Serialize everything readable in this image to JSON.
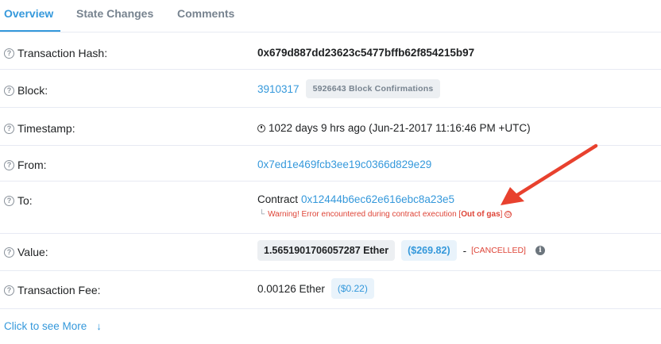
{
  "tabs": [
    {
      "label": "Overview",
      "active": true
    },
    {
      "label": "State Changes",
      "active": false
    },
    {
      "label": "Comments",
      "active": false
    }
  ],
  "rows": {
    "tx_hash": {
      "label": "Transaction Hash:",
      "value": "0x679d887dd23623c5477bffb62f854215b97"
    },
    "block": {
      "label": "Block:",
      "number": "3910317",
      "confirmations": "5926643 Block Confirmations"
    },
    "timestamp": {
      "label": "Timestamp:",
      "value": "1022 days 9 hrs ago (Jun-21-2017 11:16:46 PM +UTC)"
    },
    "from": {
      "label": "From:",
      "address": "0x7ed1e469fcb3ee19c0366d829e29"
    },
    "to": {
      "label": "To:",
      "prefix": "Contract",
      "address": "0x12444b6ec62e616ebc8a23e5",
      "warning": "Warning! Error encountered during contract execution [",
      "warning_bold": "Out of gas",
      "warning_end": "]"
    },
    "value": {
      "label": "Value:",
      "ether": "1.5651901706057287 Ether",
      "usd": "($269.82)",
      "dash": "-",
      "status": "[CANCELLED]"
    },
    "fee": {
      "label": "Transaction Fee:",
      "ether": "0.00126 Ether",
      "usd": "($0.22)"
    }
  },
  "more": {
    "label": "Click to see More"
  },
  "colors": {
    "accent": "#3498db",
    "error": "#de4437",
    "annotation": "#e8412e"
  }
}
